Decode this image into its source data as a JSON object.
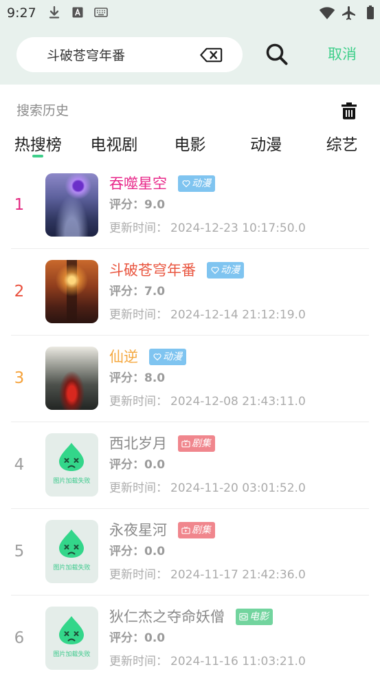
{
  "status_bar": {
    "time": "9:27",
    "left_icons": [
      "download-icon",
      "text-a-icon",
      "keyboard-icon"
    ],
    "right_icons": [
      "wifi-icon",
      "airplane-mode-icon",
      "battery-icon"
    ]
  },
  "search": {
    "value": "斗破苍穹年番",
    "clear_icon": "backspace-clear-icon",
    "search_icon": "search-icon",
    "cancel_label": "取消"
  },
  "history": {
    "title": "搜索历史",
    "delete_icon": "trash-icon"
  },
  "tabs": [
    {
      "label": "热搜榜",
      "selected": true
    },
    {
      "label": "电视剧",
      "selected": false
    },
    {
      "label": "电影",
      "selected": false
    },
    {
      "label": "动漫",
      "selected": false
    },
    {
      "label": "综艺",
      "selected": false
    }
  ],
  "labels": {
    "score": "评分：",
    "update_time": "更新时间："
  },
  "thumbnail_placeholder": {
    "icon": "image-load-failed-icon",
    "text": "图片加载失败"
  },
  "colors": {
    "accent": "#3ecf8a",
    "header_bg": "#e8f1ed"
  },
  "items": [
    {
      "rank": "1",
      "title": "吞噬星空",
      "badge": {
        "label": "动漫",
        "icon": "heart-icon",
        "color": "#7fc4f0"
      },
      "score": "9.0",
      "update_time": "2024-12-23 10:17:50.0",
      "thumbnail_loaded": true,
      "rank_color": "#e3267f",
      "title_color": "#e8288a"
    },
    {
      "rank": "2",
      "title": "斗破苍穹年番",
      "badge": {
        "label": "动漫",
        "icon": "heart-icon",
        "color": "#7fc4f0"
      },
      "score": "7.0",
      "update_time": "2024-12-14 21:12:19.0",
      "thumbnail_loaded": true,
      "rank_color": "#e94e3b",
      "title_color": "#e9553f"
    },
    {
      "rank": "3",
      "title": "仙逆",
      "badge": {
        "label": "动漫",
        "icon": "heart-icon",
        "color": "#7fc4f0"
      },
      "score": "8.0",
      "update_time": "2024-12-08 21:43:11.0",
      "thumbnail_loaded": true,
      "rank_color": "#f5a23a",
      "title_color": "#f5a83f"
    },
    {
      "rank": "4",
      "title": "西北岁月",
      "badge": {
        "label": "剧集",
        "icon": "tv-icon",
        "color": "#f0868d"
      },
      "score": "0.0",
      "update_time": "2024-11-20 03:01:52.0",
      "thumbnail_loaded": false,
      "rank_color": "#9e9e9e",
      "title_color": "#8a8a8a"
    },
    {
      "rank": "5",
      "title": "永夜星河",
      "badge": {
        "label": "剧集",
        "icon": "tv-icon",
        "color": "#f0868d"
      },
      "score": "0.0",
      "update_time": "2024-11-17 21:42:36.0",
      "thumbnail_loaded": false,
      "rank_color": "#9e9e9e",
      "title_color": "#8a8a8a"
    },
    {
      "rank": "6",
      "title": "狄仁杰之夺命妖僧",
      "badge": {
        "label": "电影",
        "icon": "film-icon",
        "color": "#72d49e"
      },
      "score": "0.0",
      "update_time": "2024-11-16 11:03:21.0",
      "thumbnail_loaded": false,
      "rank_color": "#9e9e9e",
      "title_color": "#8a8a8a"
    }
  ]
}
